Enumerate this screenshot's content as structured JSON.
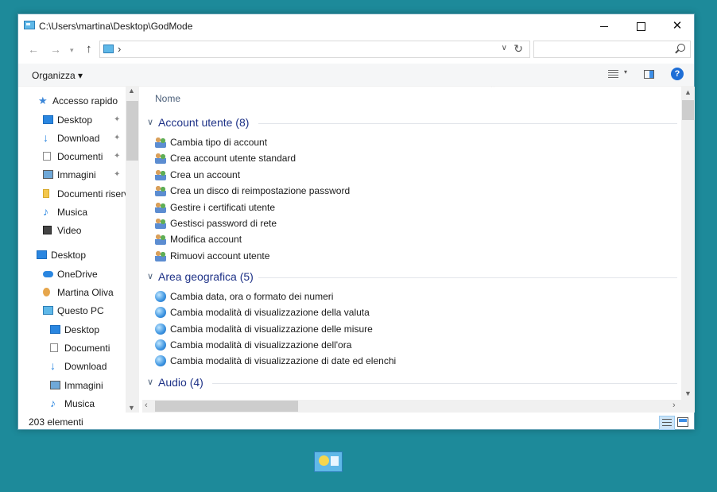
{
  "window": {
    "title": "C:\\Users\\martina\\Desktop\\GodMode",
    "minimize_glyph": "",
    "maximize_glyph": "",
    "close_glyph": "✕"
  },
  "navbar": {
    "back_glyph": "←",
    "forward_glyph": "→",
    "recent_glyph": "▾",
    "up_glyph": "↑",
    "address_chevron": "›",
    "address_dropdown_glyph": "∨",
    "refresh_glyph": "↻",
    "search_placeholder": ""
  },
  "command_bar": {
    "organize_label": "Organizza ▾",
    "view_dropdown_glyph": "▾",
    "help_glyph": "?"
  },
  "sidebar": {
    "items": [
      {
        "label": "Accesso rapido",
        "icon": "star-icon"
      },
      {
        "label": "Desktop",
        "icon": "desktop-icon",
        "pinned": true
      },
      {
        "label": "Download",
        "icon": "download-icon",
        "pinned": true
      },
      {
        "label": "Documenti",
        "icon": "documents-icon",
        "pinned": true
      },
      {
        "label": "Immagini",
        "icon": "pictures-icon",
        "pinned": true
      },
      {
        "label": "Documenti riservati",
        "icon": "folder-icon"
      },
      {
        "label": "Musica",
        "icon": "music-icon"
      },
      {
        "label": "Video",
        "icon": "video-icon"
      },
      {
        "label": "Desktop",
        "icon": "desktop-icon"
      },
      {
        "label": "OneDrive",
        "icon": "onedrive-icon"
      },
      {
        "label": "Martina Oliva",
        "icon": "user-icon"
      },
      {
        "label": "Questo PC",
        "icon": "pc-icon"
      },
      {
        "label": "Desktop",
        "icon": "desktop-icon"
      },
      {
        "label": "Documenti",
        "icon": "documents-icon"
      },
      {
        "label": "Download",
        "icon": "download-icon"
      },
      {
        "label": "Immagini",
        "icon": "pictures-icon"
      },
      {
        "label": "Musica",
        "icon": "music-icon"
      }
    ],
    "pin_glyph": "📌",
    "scroll_up_glyph": "▲",
    "scroll_down_glyph": "▼"
  },
  "content": {
    "column_header": "Nome",
    "sort_glyph": "⌃",
    "group_chevron": "∨",
    "groups": [
      {
        "label": "Account utente (8)",
        "icon": "users-icon",
        "items": [
          "Cambia tipo di account",
          "Crea account utente standard",
          "Crea un account",
          "Crea un disco di reimpostazione password",
          "Gestire i certificati utente",
          "Gestisci password di rete",
          "Modifica account",
          "Rimuovi account utente"
        ]
      },
      {
        "label": "Area geografica (5)",
        "icon": "globe-icon",
        "items": [
          "Cambia data, ora o formato dei numeri",
          "Cambia modalità di visualizzazione della valuta",
          "Cambia modalità di visualizzazione delle misure",
          "Cambia modalità di visualizzazione dell'ora",
          "Cambia modalità di visualizzazione di date ed elenchi"
        ]
      },
      {
        "label": "Audio (4)",
        "icon": "speaker-icon",
        "items": []
      }
    ],
    "scroll_up_glyph": "▲",
    "scroll_down_glyph": "▼",
    "scroll_left_glyph": "‹",
    "scroll_right_glyph": "›"
  },
  "status": {
    "count_label": "203 elementi"
  }
}
